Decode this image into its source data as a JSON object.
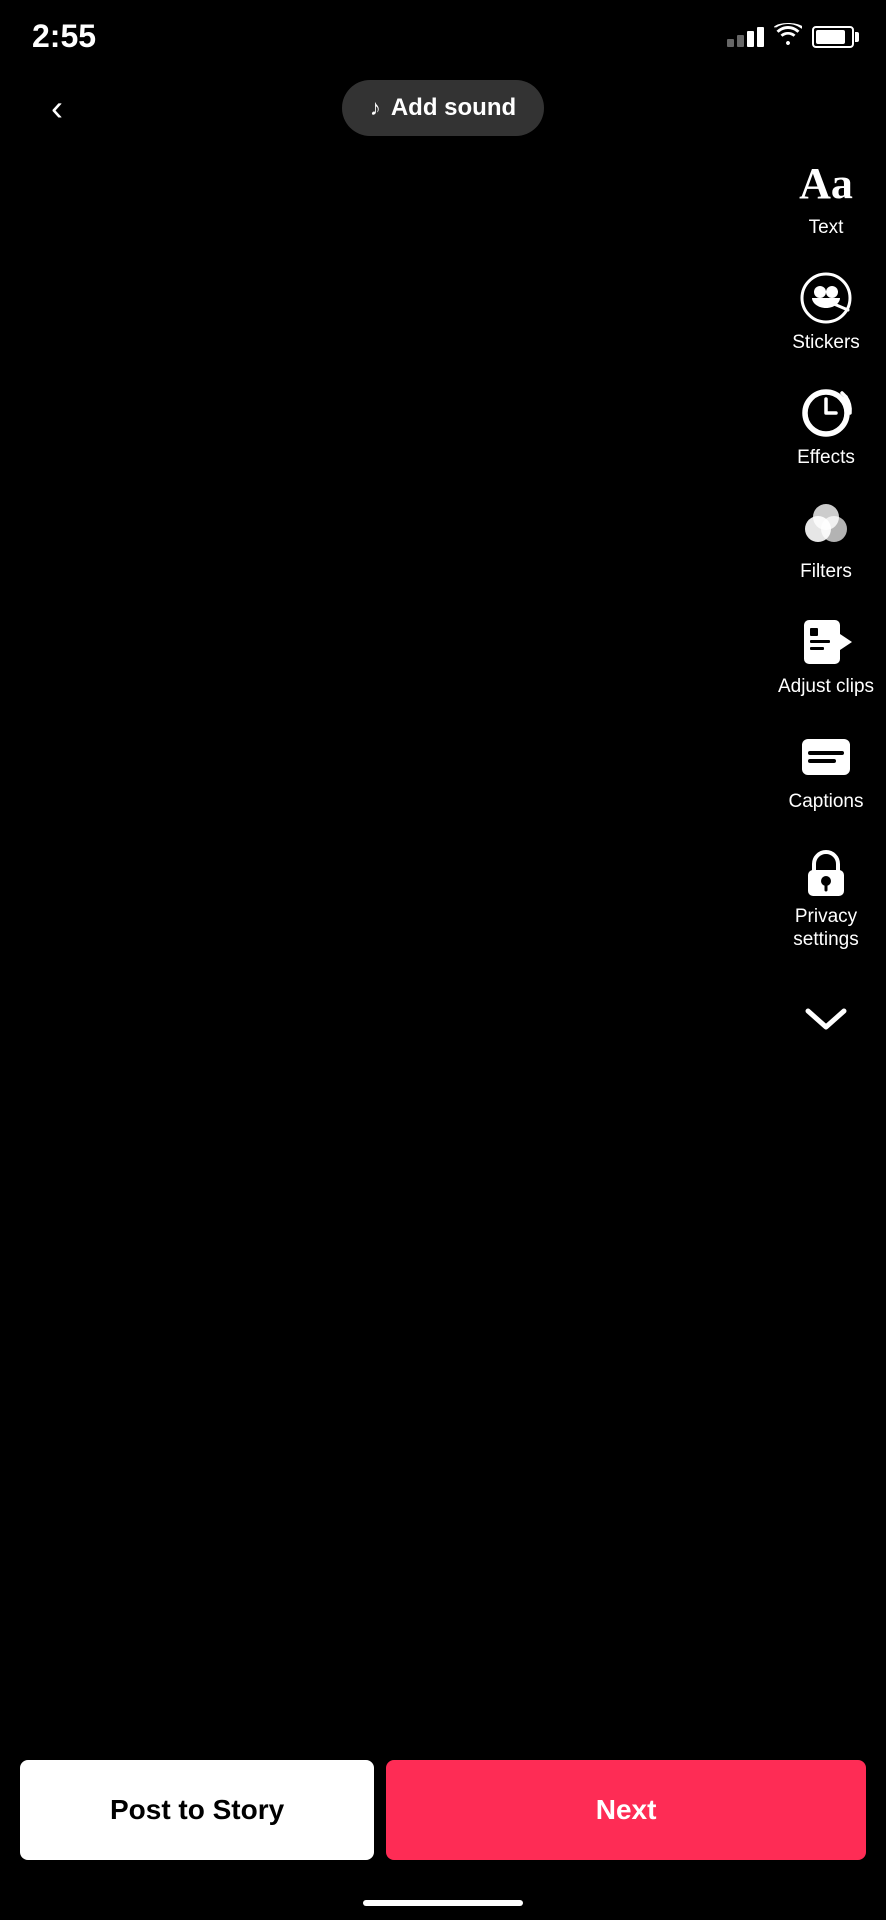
{
  "statusBar": {
    "time": "2:55",
    "signalBars": [
      6,
      9,
      12,
      15
    ],
    "batteryPercent": 85
  },
  "topBar": {
    "backLabel": "‹",
    "addSoundLabel": "Add sound",
    "addSoundIcon": "♪"
  },
  "toolbar": {
    "items": [
      {
        "id": "text",
        "label": "Text",
        "iconType": "text"
      },
      {
        "id": "stickers",
        "label": "Stickers",
        "iconType": "sticker"
      },
      {
        "id": "effects",
        "label": "Effects",
        "iconType": "effects"
      },
      {
        "id": "filters",
        "label": "Filters",
        "iconType": "filters"
      },
      {
        "id": "adjust-clips",
        "label": "Adjust clips",
        "iconType": "adjust"
      },
      {
        "id": "captions",
        "label": "Captions",
        "iconType": "captions"
      },
      {
        "id": "privacy-settings",
        "label": "Privacy\nsettings",
        "iconType": "privacy"
      }
    ],
    "chevronLabel": "⌄"
  },
  "bottomBar": {
    "postToStoryLabel": "Post to Story",
    "nextLabel": "Next"
  }
}
